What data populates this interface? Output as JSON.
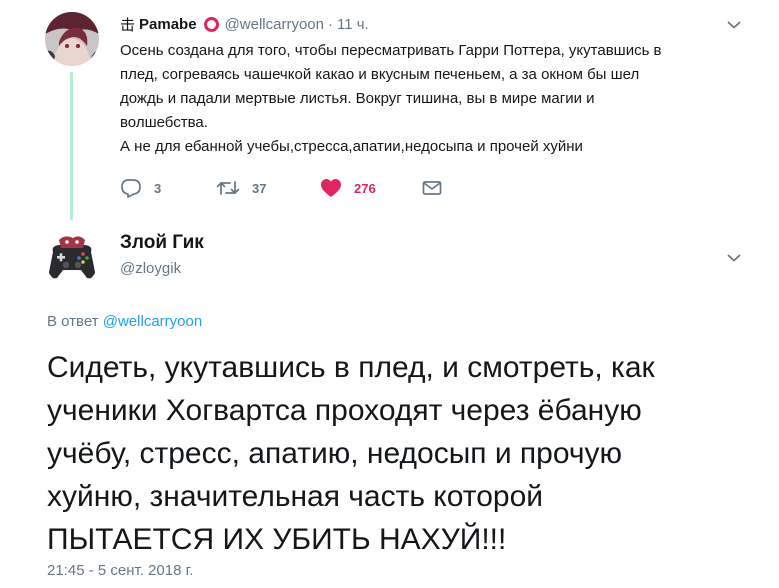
{
  "tweet1": {
    "name_prefix": "击",
    "name": "Pamabe",
    "handle": "@wellcarryoon",
    "separator": "·",
    "time": "11 ч.",
    "text_lines": [
      "Осень создана для того, чтобы пересматривать Гарри Поттера, укутавшись в",
      "плед, согреваясь чашечкой какао и вкусным печеньем, а за окном бы шел",
      "дождь и падали мертвые листья. Вокруг тишина, вы в мире магии и",
      "волшебства.",
      "А не для ебанной учебы,стресса,апатии,недосыпа и прочей хуйни"
    ],
    "replies": "3",
    "retweets": "37",
    "likes": "276",
    "icons": {
      "reply": "reply-bubble-icon",
      "retweet": "retweet-icon",
      "like": "heart-icon",
      "dm": "envelope-icon",
      "more": "chevron-down-icon",
      "badge": "red-circle-icon"
    },
    "colors": {
      "like_active": "#e0245e",
      "thread_line": "#b7ecd4"
    }
  },
  "tweet2": {
    "name": "Злой Гик",
    "handle": "@zloygik",
    "reply_label": "В ответ",
    "reply_mention": "@wellcarryoon",
    "text_lines": [
      "Сидеть, укутавшись в плед, и смотреть, как",
      "ученики Хогвартса проходят через ёбаную",
      "учёбу, стресс, апатию, недосып и прочую",
      "хуйню, значительная часть которой",
      "ПЫТАЕТСЯ ИХ УБИТЬ НАХУЙ!!!"
    ],
    "timestamp": "21:45 - 5 сент. 2018 г.",
    "colors": {
      "mention": "#1da1f2",
      "secondary": "#657786"
    }
  }
}
